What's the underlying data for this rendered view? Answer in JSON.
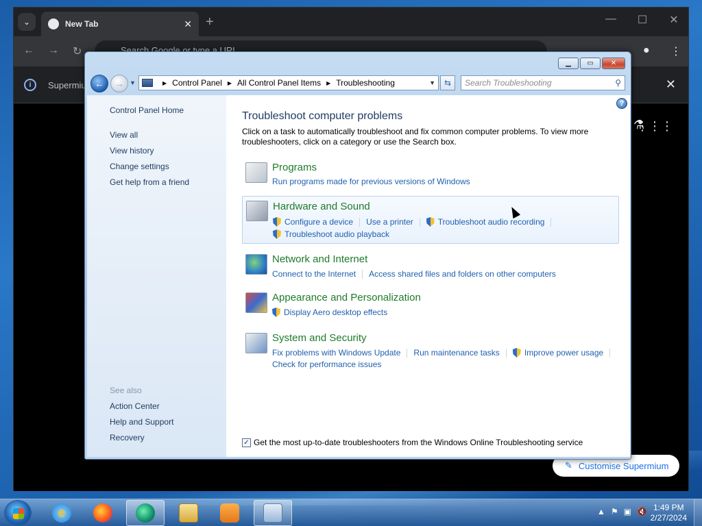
{
  "browser": {
    "tab_title": "New Tab",
    "omnibox_placeholder": "Search Google or type a URL",
    "infobar_text": "Supermium",
    "customise_label": "Customise Supermium"
  },
  "window": {
    "address": {
      "crumbs": [
        "Control Panel",
        "All Control Panel Items",
        "Troubleshooting"
      ]
    },
    "search_placeholder": "Search Troubleshooting",
    "nav": {
      "home": "Control Panel Home",
      "view_all": "View all",
      "view_history": "View history",
      "change_settings": "Change settings",
      "get_help": "Get help from a friend",
      "see_also": "See also",
      "action_center": "Action Center",
      "help_support": "Help and Support",
      "recovery": "Recovery"
    },
    "main": {
      "title": "Troubleshoot computer problems",
      "description": "Click on a task to automatically troubleshoot and fix common computer problems. To view more troubleshooters, click on a category or use the Search box.",
      "categories": [
        {
          "name": "Programs",
          "links": [
            "Run programs made for previous versions of Windows"
          ]
        },
        {
          "name": "Hardware and Sound",
          "links": [
            "Configure a device",
            "Use a printer",
            "Troubleshoot audio recording",
            "Troubleshoot audio playback"
          ]
        },
        {
          "name": "Network and Internet",
          "links": [
            "Connect to the Internet",
            "Access shared files and folders on other computers"
          ]
        },
        {
          "name": "Appearance and Personalization",
          "links": [
            "Display Aero desktop effects"
          ]
        },
        {
          "name": "System and Security",
          "links": [
            "Fix problems with Windows Update",
            "Run maintenance tasks",
            "Improve power usage",
            "Check for performance issues"
          ]
        }
      ],
      "footer_checkbox": "Get the most up-to-date troubleshooters from the Windows Online Troubleshooting service",
      "footer_checked": true
    }
  },
  "taskbar": {
    "time": "1:49 PM",
    "date": "2/27/2024",
    "apps": [
      "internet-explorer",
      "firefox",
      "supermium",
      "file-explorer",
      "windows-media-player",
      "control-panel"
    ]
  }
}
